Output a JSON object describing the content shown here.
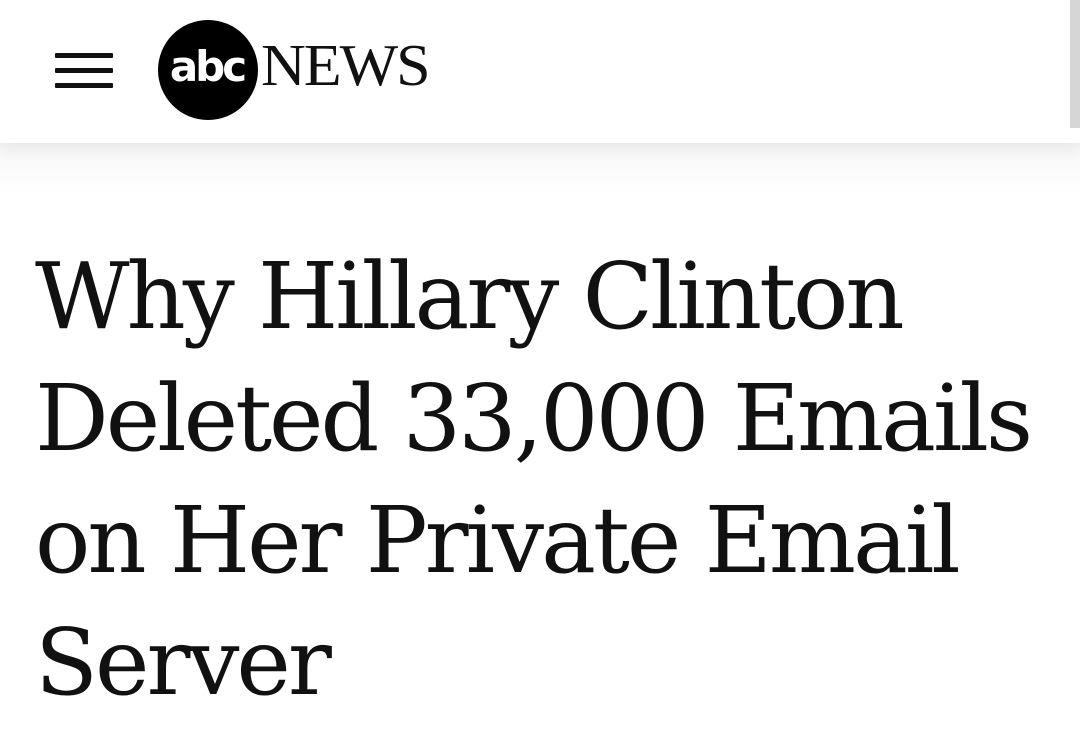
{
  "header": {
    "menu_icon": "hamburger-menu-icon",
    "logo": {
      "mark_text": "abc",
      "word_text": "NEWS"
    }
  },
  "article": {
    "headline": "Why Hillary Clinton Deleted 33,000 Emails on Her Private Email Server"
  },
  "colors": {
    "text": "#111111",
    "background": "#ffffff",
    "logo_circle": "#000000"
  }
}
